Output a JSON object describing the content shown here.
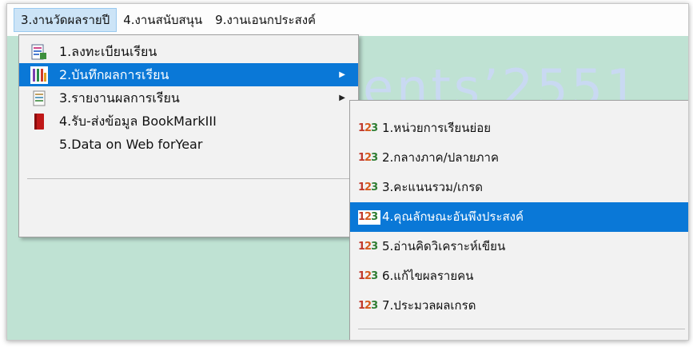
{
  "menubar": {
    "items": [
      {
        "label": "3.งานวัดผลรายปี",
        "active": true
      },
      {
        "label": "4.งานสนับสนุน",
        "active": false
      },
      {
        "label": "9.งานเอนกประสงค์",
        "active": false
      }
    ]
  },
  "background": {
    "banner_text": "ents’2551"
  },
  "main_menu": {
    "items": [
      {
        "label": "1.ลงทะเบียนเรียน",
        "icon": "register-form-icon",
        "has_submenu": false,
        "highlighted": false
      },
      {
        "label": "2.บันทึกผลการเรียน",
        "icon": "record-grades-icon",
        "has_submenu": true,
        "highlighted": true
      },
      {
        "label": "3.รายงานผลการเรียน",
        "icon": "report-icon",
        "has_submenu": true,
        "highlighted": false
      },
      {
        "label": "4.รับ-ส่งข้อมูล BookMarkIII",
        "icon": "red-book-icon",
        "has_submenu": false,
        "highlighted": false
      },
      {
        "label": "5.Data on Web forYear",
        "icon": "",
        "has_submenu": false,
        "highlighted": false
      }
    ]
  },
  "sub_menu": {
    "icon_text": {
      "d1": "1",
      "d2": "2",
      "d3": "3"
    },
    "items": [
      {
        "label": "1.หน่วยการเรียนย่อย",
        "highlighted": false
      },
      {
        "label": "2.กลางภาค/ปลายภาค",
        "highlighted": false
      },
      {
        "label": "3.คะแนนรวม/เกรด",
        "highlighted": false
      },
      {
        "label": "4.คุณลักษณะอันพึงประสงค์",
        "highlighted": true
      },
      {
        "label": "5.อ่านคิดวิเคราะห์เขียน",
        "highlighted": false
      },
      {
        "label": "6.แก้ไขผลรายคน",
        "highlighted": false
      },
      {
        "label": "7.ประมวลผลเกรด",
        "highlighted": false
      }
    ]
  },
  "colors": {
    "highlight": "#0a78d7",
    "menubar_active": "#cce4f7",
    "workspace": "#bfe2d3"
  }
}
